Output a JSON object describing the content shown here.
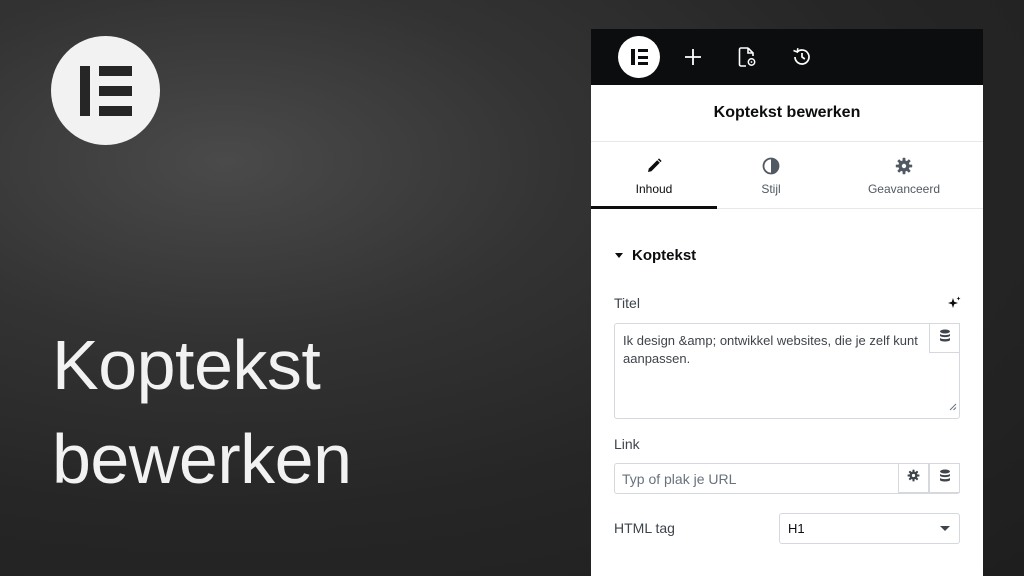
{
  "hero": {
    "title_line1": "Koptekst",
    "title_line2": "bewerken"
  },
  "topbar": {
    "icons": [
      "elementor-logo-icon",
      "plus-icon",
      "page-settings-icon",
      "history-icon"
    ]
  },
  "panel": {
    "header_title": "Koptekst bewerken",
    "tabs": [
      {
        "label": "Inhoud",
        "icon": "pencil-icon",
        "active": true
      },
      {
        "label": "Stijl",
        "icon": "half-circle-icon",
        "active": false
      },
      {
        "label": "Geavanceerd",
        "icon": "gear-icon",
        "active": false
      }
    ],
    "section_title": "Koptekst",
    "title_field": {
      "label": "Titel",
      "value": "Ik design &amp; ontwikkel websites, die je zelf kunt aanpassen."
    },
    "link_field": {
      "label": "Link",
      "placeholder": "Typ of plak je URL"
    },
    "html_tag": {
      "label": "HTML tag",
      "value": "H1"
    }
  },
  "colors": {
    "topbar_bg": "#0c0d0e",
    "panel_bg": "#ffffff",
    "border": "#d5d8dc",
    "text": "#3f444b"
  }
}
